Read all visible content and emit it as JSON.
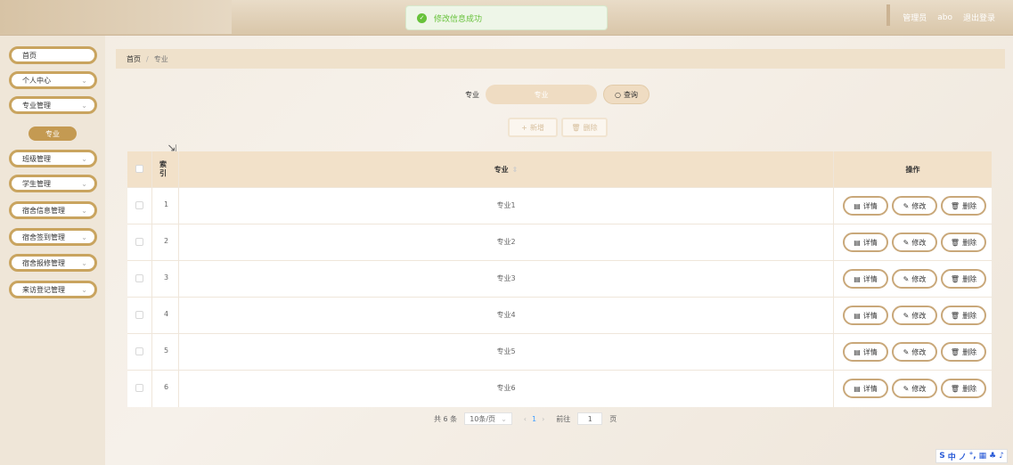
{
  "header": {
    "user_role": "管理员",
    "username": "abo",
    "logout": "退出登录"
  },
  "toast": {
    "message": "修改信息成功"
  },
  "sidebar": {
    "items": [
      {
        "label": "首页"
      },
      {
        "label": "个人中心"
      },
      {
        "label": "专业管理"
      },
      {
        "label": "专业",
        "sub": true
      },
      {
        "label": "班级管理"
      },
      {
        "label": "学生管理"
      },
      {
        "label": "宿舍信息管理"
      },
      {
        "label": "宿舍签到管理"
      },
      {
        "label": "宿舍报修管理"
      },
      {
        "label": "来访登记管理"
      }
    ]
  },
  "breadcrumb": {
    "home": "首页",
    "sep": "/",
    "current": "专业"
  },
  "search": {
    "label": "专业",
    "placeholder": "专业",
    "button": "查询",
    "add_button": "新增",
    "delete_button": "删除"
  },
  "table": {
    "headers": {
      "index": "索引",
      "major": "专业",
      "ops": "操作"
    },
    "ops": {
      "detail": "详情",
      "edit": "修改",
      "delete": "删除"
    },
    "rows": [
      {
        "index": "1",
        "major": "专业1"
      },
      {
        "index": "2",
        "major": "专业2"
      },
      {
        "index": "3",
        "major": "专业3"
      },
      {
        "index": "4",
        "major": "专业4"
      },
      {
        "index": "5",
        "major": "专业5"
      },
      {
        "index": "6",
        "major": "专业6"
      }
    ]
  },
  "pagination": {
    "total": "共 6 条",
    "page_size": "10条/页",
    "current_page": "1",
    "goto_label": "前往",
    "goto_value": "1",
    "page_suffix": "页"
  },
  "ime": [
    "S",
    "中",
    "ノ",
    "°,",
    "▦",
    "♣",
    "♪"
  ],
  "colors": {
    "accent": "#c9a45f",
    "accent_fill": "#c49a52",
    "header_bg": "#f2e1c9",
    "success": "#67c23a"
  }
}
